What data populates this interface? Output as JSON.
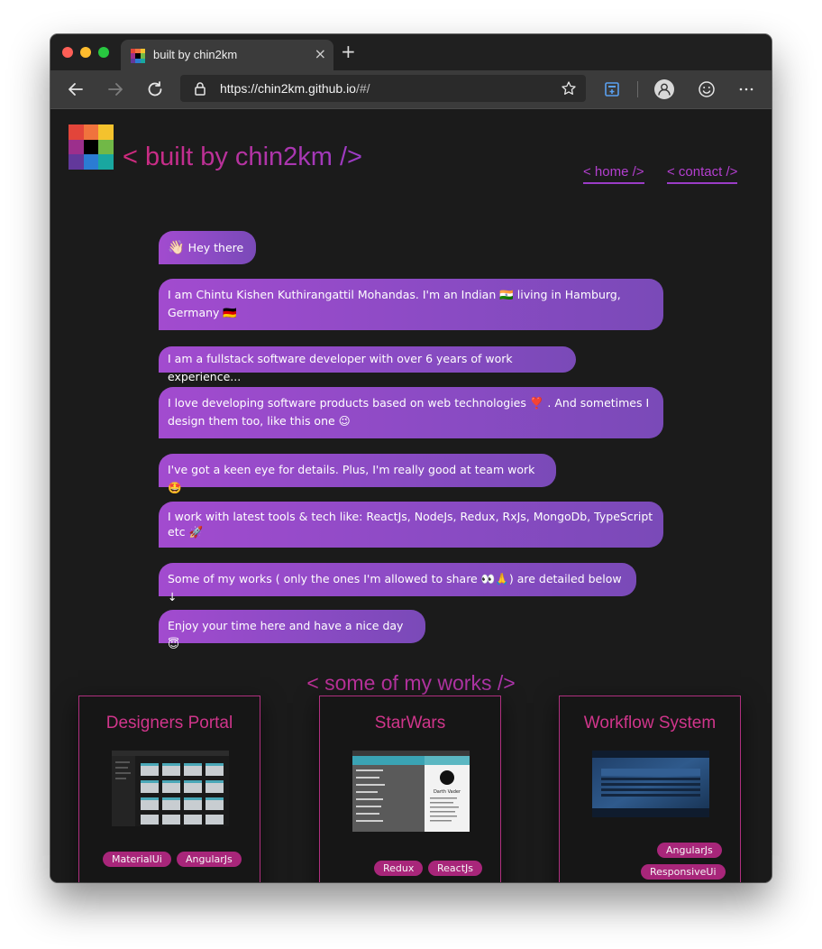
{
  "browser": {
    "tab_title": "built by chin2km",
    "tab_close": "×",
    "new_tab": "+",
    "url_host": "https://chin2km.github.io",
    "url_path": "/#/"
  },
  "header": {
    "title": "< built by chin2km />",
    "nav": [
      {
        "label": "< home />"
      },
      {
        "label": "< contact />"
      }
    ]
  },
  "messages": [
    {
      "text": "Hey there",
      "emoji": "👋🏻"
    },
    {
      "text": "I am Chintu Kishen Kuthirangattil Mohandas. I'm an Indian 🇮🇳 living in Hamburg, Germany 🇩🇪"
    },
    {
      "text": "I am a fullstack software developer with over 6 years of work experience..."
    },
    {
      "text": "I love developing software products based on web technologies ❣️ . And sometimes I design them too, like this one 😉"
    },
    {
      "text": "I've got a keen eye for details. Plus, I'm really good at team work 🤩"
    },
    {
      "text": "I work with latest tools & tech like: ReactJs, NodeJs, Redux, RxJs, MongoDb, TypeScript etc 🚀"
    },
    {
      "text": "Some of my works ( only the ones I'm allowed to share 👀🙏) are detailed below ↓"
    },
    {
      "text": "Enjoy your time here and have a nice day 😇"
    }
  ],
  "works": {
    "title": "< some of my works />",
    "cards": [
      {
        "title": "Designers Portal",
        "tags": [
          "MaterialUi",
          "AngularJs"
        ]
      },
      {
        "title": "StarWars",
        "tags": [
          "Redux",
          "ReactJs"
        ],
        "shot_caption": "Darth Vader"
      },
      {
        "title": "Workflow System",
        "tags": [
          "AngularJs",
          "ResponsiveUi"
        ]
      }
    ]
  },
  "colors": {
    "accent_pink": "#d02a7c",
    "accent_purple": "#9b3cc7",
    "bubble": "#8b4bc4",
    "tag": "#a8267a",
    "background": "#1b1b1b"
  }
}
